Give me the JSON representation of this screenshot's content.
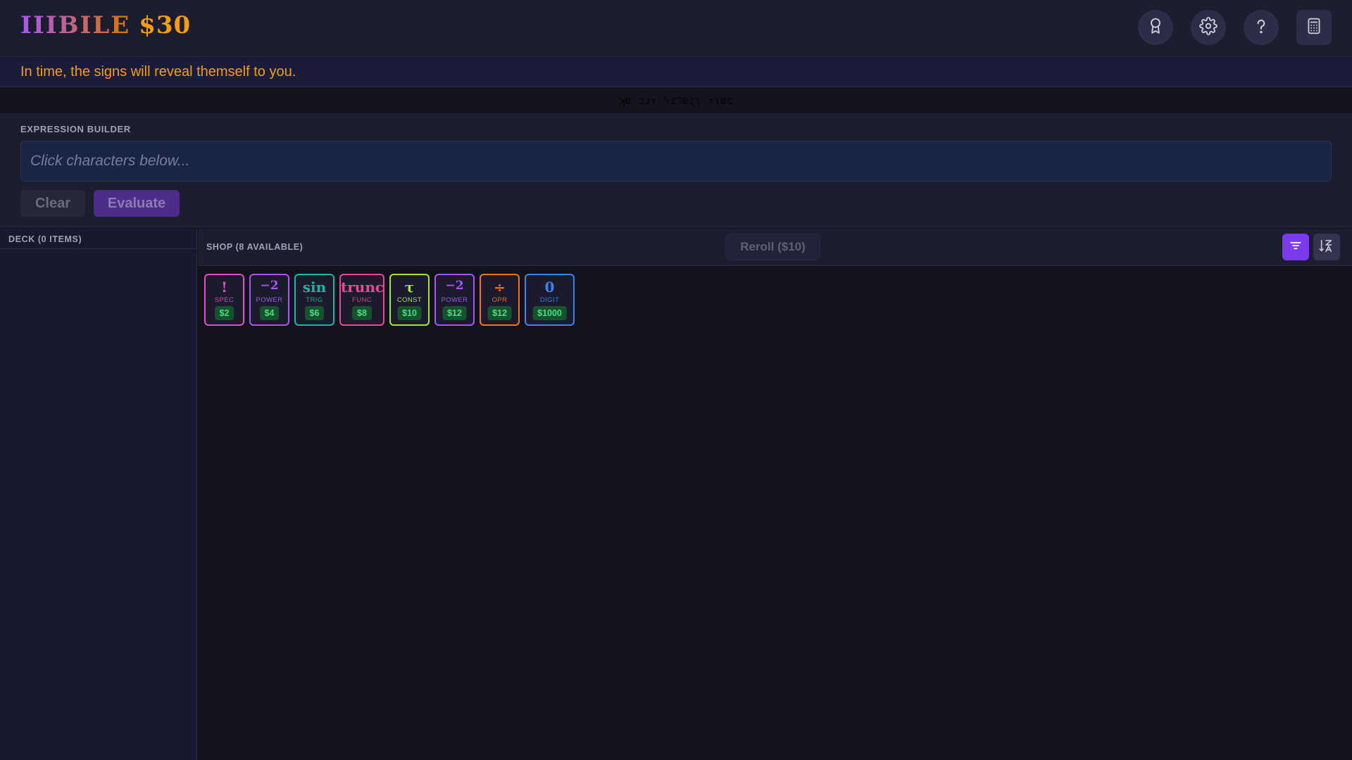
{
  "header": {
    "brand": "IIIBILE",
    "money": "$30",
    "buttons": [
      {
        "name": "achievements-button",
        "icon": "award-icon"
      },
      {
        "name": "settings-button",
        "icon": "gear-icon"
      },
      {
        "name": "help-button",
        "icon": "question-icon"
      },
      {
        "name": "calculator-button",
        "icon": "calculator-icon"
      }
    ]
  },
  "hint": {
    "text": "In time, the signs will reveal themself to you."
  },
  "cipher": {
    "text": "ʞɐ ɔɹ↑ ϟɾ˥ɐʐʅ ↑ɩɐɕ"
  },
  "expression_builder": {
    "title": "EXPRESSION BUILDER",
    "placeholder": "Click characters below...",
    "value": "",
    "clear_label": "Clear",
    "evaluate_label": "Evaluate"
  },
  "deck": {
    "title": "DECK (0 ITEMS)",
    "items": []
  },
  "shop": {
    "title": "SHOP (8 AVAILABLE)",
    "reroll_label": "Reroll ($10)",
    "filter_icon": "filter-icon",
    "sort_icon": "sort-icon",
    "items": [
      {
        "symbol": "!",
        "category": "SPEC",
        "price": "$2"
      },
      {
        "symbol": "−2",
        "category": "POWER",
        "price": "$4"
      },
      {
        "symbol": "sin",
        "category": "TRIG",
        "price": "$6"
      },
      {
        "symbol": "trunc",
        "category": "FUNC",
        "price": "$8"
      },
      {
        "symbol": "τ",
        "category": "CONST",
        "price": "$10"
      },
      {
        "symbol": "−2",
        "category": "POWER",
        "price": "$12"
      },
      {
        "symbol": "÷",
        "category": "OPR",
        "price": "$12"
      },
      {
        "symbol": "0",
        "category": "DIGIT",
        "price": "$1000"
      }
    ]
  },
  "colors": {
    "accent": "#7c3aed",
    "money": "#f59e0b",
    "spec": "#e74acb",
    "power": "#a855f7",
    "trig": "#14b8a6",
    "func": "#ec4899",
    "const": "#a3e635",
    "opr": "#f97316",
    "digit": "#3b82f6",
    "price_text": "#4ade80"
  }
}
